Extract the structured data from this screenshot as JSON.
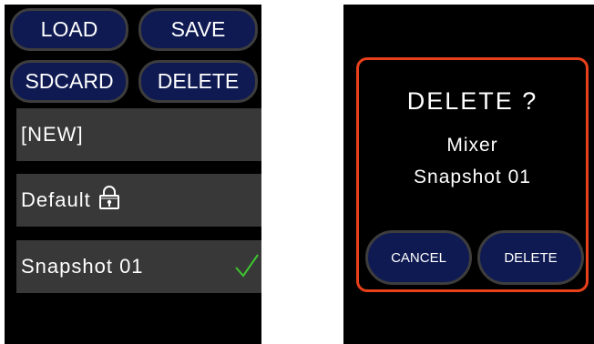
{
  "menu": {
    "load_label": "LOAD",
    "save_label": "SAVE",
    "sdcard_label": "SDCARD",
    "delete_label": "DELETE"
  },
  "list": {
    "items": [
      {
        "label": "[NEW]"
      },
      {
        "label": "Default",
        "icon": "lock-icon"
      },
      {
        "label": "Snapshot 01",
        "icon": "checkmark-icon",
        "selected": true
      }
    ]
  },
  "dialog": {
    "title": "DELETE ?",
    "line1": "Mixer",
    "line2": "Snapshot 01",
    "cancel_label": "CANCEL",
    "confirm_label": "DELETE"
  },
  "colors": {
    "screen_bg": "#000000",
    "button_fill": "#0f1a52",
    "button_border": "#3d3d3d",
    "row_bg": "#383838",
    "check": "#3cc62e",
    "dialog_border": "#e8401a"
  }
}
